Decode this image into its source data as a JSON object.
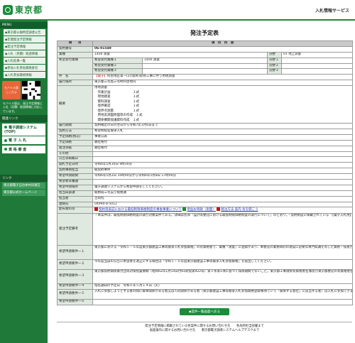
{
  "header": {
    "logo_text": "東京都",
    "site_title": "入札情報サービス"
  },
  "sidebar": {
    "menu_head": "MENU",
    "links": [
      "◆東京都公報特定調達公告",
      "◆年間発注予定情報",
      "◆発注予定情報",
      "◆入札（見積）経過情報",
      "◆入札結果一覧",
      "◆参加入札参加資格者名",
      "◆入札参加資格情報"
    ],
    "mobile_badge": "モバイル版",
    "mobile_badge_sub": "ここだよ",
    "mobile_note": "モバイル版は、発注予定情報と入札（見積）経過情報に対応しています。",
    "links_head": "関連リンク",
    "big_buttons": [
      "電子調達システム(TOP)",
      "電 子 入 札",
      "資 格 審 査"
    ],
    "footer_head": "リンク",
    "footer_links": [
      "東京都電子自治体共同運営",
      "東京都公式ホームページ"
    ]
  },
  "main": {
    "title": "発注予定表",
    "table_head": {
      "item": "項　　目",
      "content": "項　目　内　容"
    },
    "contract_no": {
      "label": "契約番号",
      "value": "06-01549"
    },
    "category": {
      "label": "業種",
      "value": "1400 測量",
      "sub_label": "分野",
      "sub_value": "01 地上測量"
    },
    "desired": {
      "label": "希望受付業種",
      "rows": [
        {
          "label": "希望受付業種１",
          "value": "1400 測量",
          "sub_label": "分野１",
          "sub_value": ""
        },
        {
          "label": "希望受付業種２",
          "value": "",
          "sub_label": "分野２",
          "sub_value": ""
        },
        {
          "label": "希望受付業種３",
          "value": "",
          "sub_label": "分野３",
          "sub_value": ""
        }
      ]
    },
    "name": {
      "label": "件　名",
      "tag": "【電子】",
      "value": "阿古地区第一(2)(仮称)砂防工事に伴う用地測量"
    },
    "location": {
      "label": "履行場所",
      "value": "東京都三宅島三宅村阿古地内"
    },
    "summary": {
      "label": "概要",
      "lines": [
        "用地測量",
        "　作業計画　　　　　　　１式",
        "　現地踏査　　　　　　　１式",
        "　資料調査　　　　　　　１式",
        "　境界確認　　　　　　　１式",
        "　境界点測量　　　　　　１式",
        "　用地実測図原図等の作成　１式",
        "　関係機関協議資料作成　１式"
      ]
    },
    "period": {
      "label": "履行期間",
      "value": "契約確定の日の翌日から令和7年1月6日まで"
    },
    "method": {
      "label": "契約方法",
      "value": "希望制指名競争入札"
    },
    "budget_cat": {
      "label": "予定価格(税込)",
      "value": "事後公表"
    },
    "est_price": {
      "label": "予定価格",
      "value": "順位格付"
    },
    "min_price": {
      "label": "最低制限価格",
      "value": ""
    },
    "grade": {
      "label": "発注等級",
      "value": "順位格付"
    },
    "other": {
      "label": "その他",
      "value": ""
    },
    "announce": {
      "label": "公告等掲載日",
      "value": ""
    },
    "open_date": {
      "label": "開札予定日時",
      "value": "令和6年5月30日 9時30分"
    },
    "dept_contact": {
      "label": "契約事務担当",
      "value": "総契約事件"
    },
    "apply_period": {
      "label": "希望申請期間",
      "value": "令和6年5月2日 10時00分から令和6年5月8日 17時00分"
    },
    "spec_period": {
      "label": "希望者等審議",
      "value": ""
    },
    "apply_place": {
      "label": "希望申請場所",
      "value": "電子調達システムから希望申請をしてください。"
    },
    "office": {
      "label": "担当局部課",
      "value": "総務局三宅支庁総務課"
    },
    "person": {
      "label": "担当者",
      "value": "吉岡丸"
    },
    "phone": {
      "label": "連絡先",
      "value": "04994-8-5012"
    },
    "docs": {
      "label": "配布資料等",
      "items": [
        "契約等表記における最低制限価格制度の事後事業について",
        "現品お目録（測量）",
        "発注方法 案内 有を開こう"
      ]
    },
    "notes": {
      "label": "発注予定備考",
      "value": "・本案件は、最低制限価格制度の試行対象案件である。詳細は別添「設計等委託における最低制限価格制度の試行について」のとおり。・契約制度に掲載されている「【電子入札用】工事請負等競争入札参加合格心得（その１）（予定価格を事前公表しないもの及び委託契約関係）」をよく確認すること。・金額積算に当たっては、別添「積算内訳書（細部まで）に内訳金額を記載の上、これを入札書に添付して提出すること(詳細は、別添「設計等委託に係る積算内訳書の提出について」参照)。"
    },
    "req1": {
      "label": "希望申請要件一１",
      "value": "東京都における「令和５・６年度東京都建設工事等競争入札参加資格」の有資格者で、業種「測量」に登録があり、本委託の業務目的の達成に必要な専門知識を有した資格・技術力を保有していること。"
    },
    "req2": {
      "label": "希望申請要件一２",
      "value": "今年度当該の公告に希望者を適正にする場合は「令和５・６年度東京都建設工事等競争入札参加資格」を提出してください。"
    },
    "req3": {
      "label": "希望申請要件一３",
      "value": "東京都契約関係暴力団等対策措置要綱（昭和62年1月14日付61財契第922号）第５条第1項に基づく排除期間でないこと。東京都工事請負有資格者名簿及び東京都委託の有資格者名簿において、指名が制限されている者でないこと。"
    },
    "req4": {
      "label": "希望申請要件一４",
      "value": "指名通知の予定日　令和６年５月１４日（火）"
    },
    "req5": {
      "label": "希望申請要件一５",
      "value": "入札に参加しようとする者の間に資本関係がある者又は人的関係がある者（東京都建設工事等競争入札参加資格登録事項でいう「関係する会社」に該当する者）は入札に参加できません。"
    },
    "req6": {
      "label": "希望申請要件一６",
      "value": ""
    },
    "back_button": "◆案件一覧画面へ戻る"
  },
  "footer": {
    "line1": "発注予定情報に掲載されている各案件に関するお問い合わせ先　　各局所担当部署まで",
    "line2": "画面操作に関するお問い合わせ先　　東京都電子調達システムヘルプデスクまで"
  }
}
